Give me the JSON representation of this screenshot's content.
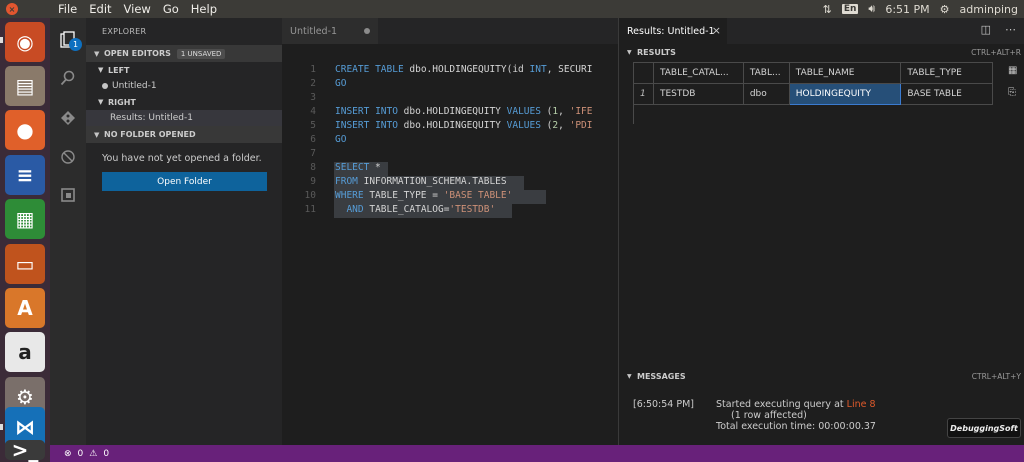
{
  "topbar": {
    "menus": [
      "File",
      "Edit",
      "View",
      "Go",
      "Help"
    ],
    "lang": "En",
    "time": "6:51 PM",
    "user": "adminping"
  },
  "launcher": {
    "items": [
      {
        "name": "ubuntu-dash",
        "color": "#c84b24",
        "glyph": "◉"
      },
      {
        "name": "files",
        "color": "#8a7a6a",
        "glyph": "▤"
      },
      {
        "name": "firefox",
        "color": "#e0602a",
        "glyph": "●"
      },
      {
        "name": "writer",
        "color": "#2a5aa5",
        "glyph": "≡"
      },
      {
        "name": "calc",
        "color": "#2e8c37",
        "glyph": "▦"
      },
      {
        "name": "impress",
        "color": "#c0531d",
        "glyph": "▭"
      },
      {
        "name": "software-center",
        "color": "#d9772a",
        "glyph": "A"
      },
      {
        "name": "amazon",
        "color": "#e8e8e8",
        "glyph": "a"
      },
      {
        "name": "settings",
        "color": "#7a6f6a",
        "glyph": "⚙"
      },
      {
        "name": "vscode",
        "color": "#1570b8",
        "glyph": "⋈"
      },
      {
        "name": "terminal",
        "color": "#3a3a3a",
        "glyph": ">_"
      }
    ]
  },
  "activity": {
    "badge": "1"
  },
  "sidebar": {
    "title": "EXPLORER",
    "open_editors": "OPEN EDITORS",
    "unsaved": "1 UNSAVED",
    "left": "LEFT",
    "left_file": "Untitled-1",
    "right": "RIGHT",
    "right_file": "Results: Untitled-1",
    "no_folder": "NO FOLDER OPENED",
    "message": "You have not yet opened a folder.",
    "open_folder": "Open Folder"
  },
  "editor": {
    "tab": "Untitled-1",
    "line_numbers": [
      "1",
      "2",
      "3",
      "4",
      "5",
      "6",
      "7",
      "8",
      "9",
      "10",
      "11"
    ],
    "lines": [
      "CREATE TABLE dbo.HOLDINGEQUITY(id INT, SECURI",
      "GO",
      "",
      "INSERT INTO dbo.HOLDINGEQUITY VALUES (1, 'IFE",
      "INSERT INTO dbo.HOLDINGEQUITY VALUES (2, 'PDI",
      "GO",
      "",
      "SELECT *",
      "FROM INFORMATION_SCHEMA.TABLES",
      "WHERE TABLE_TYPE = 'BASE TABLE'",
      "  AND TABLE_CATALOG='TESTDB'"
    ]
  },
  "results": {
    "tab": "Results: Untitled-1",
    "results_header": "RESULTS",
    "results_shortcut": "CTRL+ALT+R",
    "columns": [
      "TABLE_CATAL...",
      "TABL...",
      "TABLE_NAME",
      "TABLE_TYPE"
    ],
    "rows": [
      {
        "num": "1",
        "cells": [
          "TESTDB",
          "dbo",
          "HOLDINGEQUITY",
          "BASE TABLE"
        ]
      }
    ],
    "messages_header": "MESSAGES",
    "messages_shortcut": "CTRL+ALT+Y",
    "msg_time": "[6:50:54 PM]",
    "msg_started": "Started executing query at",
    "msg_line": "Line 8",
    "msg_rows": "(1 row affected)",
    "msg_exec": "Total execution time: 00:00:00.37",
    "watermark": "DebuggingSoft"
  },
  "status": {
    "errors": "0",
    "warnings": "0"
  }
}
